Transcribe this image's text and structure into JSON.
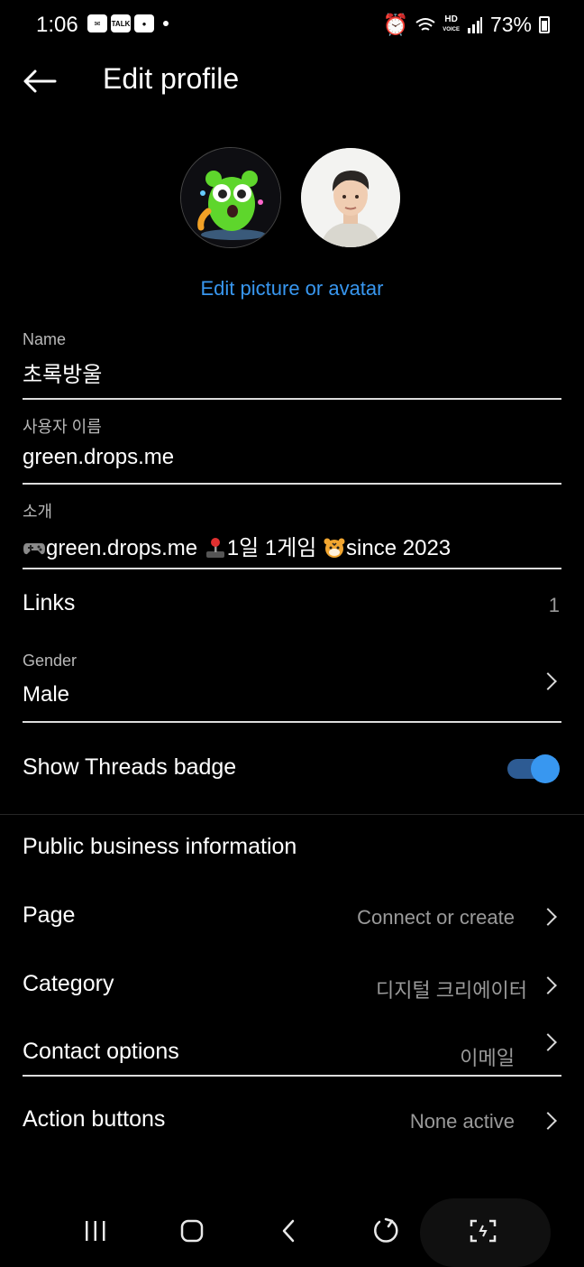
{
  "status_bar": {
    "time": "1:06",
    "talk_badge": "TALK",
    "hd_label": "HD",
    "voice_label": "VOICE",
    "battery": "73%"
  },
  "header": {
    "title": "Edit profile"
  },
  "profile": {
    "edit_picture_label": "Edit picture or avatar"
  },
  "fields": {
    "name": {
      "label": "Name",
      "value": "초록방울"
    },
    "username": {
      "label": "사용자 이름",
      "value": "green.drops.me"
    },
    "bio": {
      "label": "소개",
      "part1": "green.drops.me",
      "part2": "1일 1게임",
      "part3": "since 2023"
    }
  },
  "links": {
    "label": "Links",
    "count": "1"
  },
  "gender": {
    "label": "Gender",
    "value": "Male"
  },
  "threads_badge": {
    "label": "Show Threads badge",
    "enabled": true
  },
  "business": {
    "section_title": "Public business information",
    "page": {
      "label": "Page",
      "value": "Connect or create"
    },
    "category": {
      "label": "Category",
      "value": "디지털 크리에이터"
    },
    "contact": {
      "label": "Contact options",
      "value": "이메일"
    },
    "action_buttons": {
      "label": "Action buttons",
      "value": "None active"
    }
  },
  "colors": {
    "accent": "#3897f0",
    "background": "#000000",
    "toggle_track": "#2d5b93"
  }
}
